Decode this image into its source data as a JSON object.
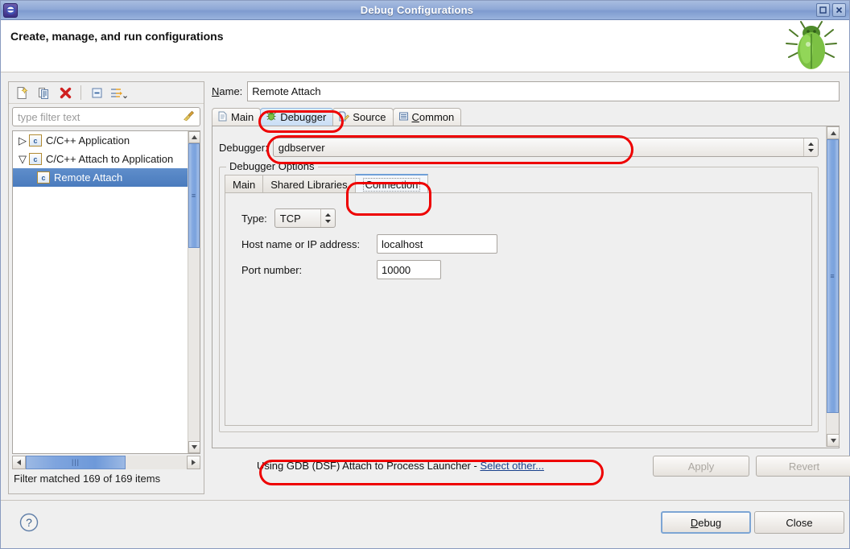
{
  "window": {
    "title": "Debug Configurations",
    "app_icon": "eclipse-icon",
    "maximize_icon": "maximize-icon",
    "close_icon": "close-icon"
  },
  "header": {
    "title": "Create, manage, and run configurations",
    "decoration_icon": "bug-icon"
  },
  "toolbar": {
    "buttons": [
      {
        "name": "new-launch-configuration",
        "icon": "new-document-icon"
      },
      {
        "name": "duplicate-configuration",
        "icon": "copy-icon"
      },
      {
        "name": "delete-configuration",
        "icon": "delete-x-icon"
      },
      {
        "name": "collapse-all",
        "icon": "collapse-all-icon"
      },
      {
        "name": "filter-menu",
        "icon": "filter-icon"
      }
    ]
  },
  "filter": {
    "placeholder": "type filter text",
    "value": "",
    "clear_icon": "broom-icon",
    "status": "Filter matched 169 of 169 items"
  },
  "tree": {
    "items": [
      {
        "label": "C/C++ Application",
        "expanded": false,
        "selected": false,
        "indent": 0,
        "icon": "c-file-icon",
        "twisty": "▷"
      },
      {
        "label": "C/C++ Attach to Application",
        "expanded": true,
        "selected": false,
        "indent": 0,
        "icon": "c-file-icon",
        "twisty": "▽"
      },
      {
        "label": "Remote Attach",
        "expanded": false,
        "selected": true,
        "indent": 1,
        "icon": "c-file-icon",
        "twisty": ""
      }
    ]
  },
  "name_field": {
    "label": "Name:",
    "label_mnemonic": "N",
    "value": "Remote Attach"
  },
  "tabs": [
    {
      "label": "Main",
      "icon": "document-icon",
      "active": false
    },
    {
      "label": "Debugger",
      "icon": "bug-small-icon",
      "active": true
    },
    {
      "label": "Source",
      "icon": "source-icon",
      "active": false
    },
    {
      "label": "Common",
      "icon": "common-icon",
      "active": false,
      "mnemonic": "C"
    }
  ],
  "debugger_tab": {
    "debugger_label": "Debugger:",
    "debugger_value": "gdbserver",
    "group_title": "Debugger Options",
    "inner_tabs": [
      {
        "label": "Main",
        "active": false
      },
      {
        "label": "Shared Libraries",
        "active": false
      },
      {
        "label": "Connection",
        "active": true
      }
    ],
    "connection": {
      "type_label": "Type:",
      "type_value": "TCP",
      "host_label": "Host name or IP address:",
      "host_value": "localhost",
      "port_label": "Port number:",
      "port_value": "10000"
    }
  },
  "launcher": {
    "prefix": "Using GDB (DSF) Attach to Process Launcher - ",
    "link": "Select other..."
  },
  "buttons": {
    "apply": "Apply",
    "revert": "Revert",
    "debug": "Debug",
    "close": "Close",
    "help_icon": "help-icon"
  },
  "colors": {
    "titlebar": "#8fa9d6",
    "selection": "#4a7bbd",
    "annotation": "#ee0000",
    "link": "#19418c"
  }
}
